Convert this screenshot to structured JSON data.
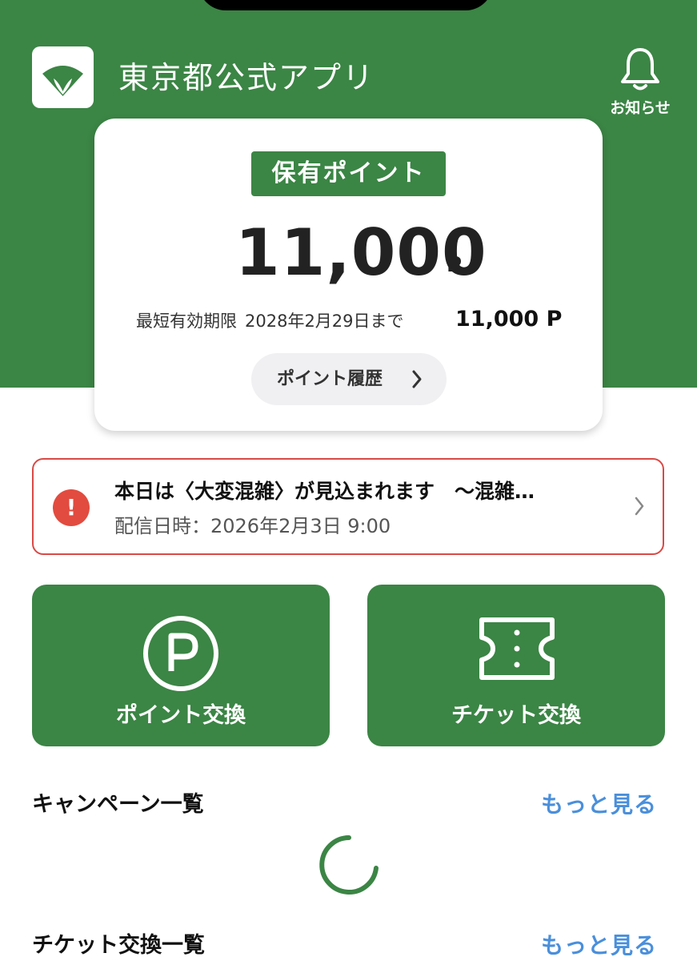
{
  "header": {
    "app_title": "東京都公式アプリ",
    "notification_label": "お知らせ"
  },
  "points_card": {
    "badge": "保有ポイント",
    "amount": "11,000",
    "unit": "P",
    "expiry_label": "最短有効期限",
    "expiry_date": "2028年2月29日まで",
    "expiry_amount": "11,000 P",
    "history_button": "ポイント履歴"
  },
  "alert": {
    "title": "本日は〈大変混雑〉が見込まれます　～混雑…",
    "date": "配信日時：2026年2月3日 9:00"
  },
  "tiles": [
    {
      "label": "ポイント交換",
      "icon": "point-circle-icon"
    },
    {
      "label": "チケット交換",
      "icon": "ticket-icon"
    }
  ],
  "sections": [
    {
      "title": "キャンペーン一覧",
      "more": "もっと見る"
    },
    {
      "title": "チケット交換一覧",
      "more": "もっと見る"
    }
  ],
  "colors": {
    "brand_green": "#3b8545",
    "alert_red": "#e24b3f",
    "link_blue": "#4a8fdb"
  }
}
